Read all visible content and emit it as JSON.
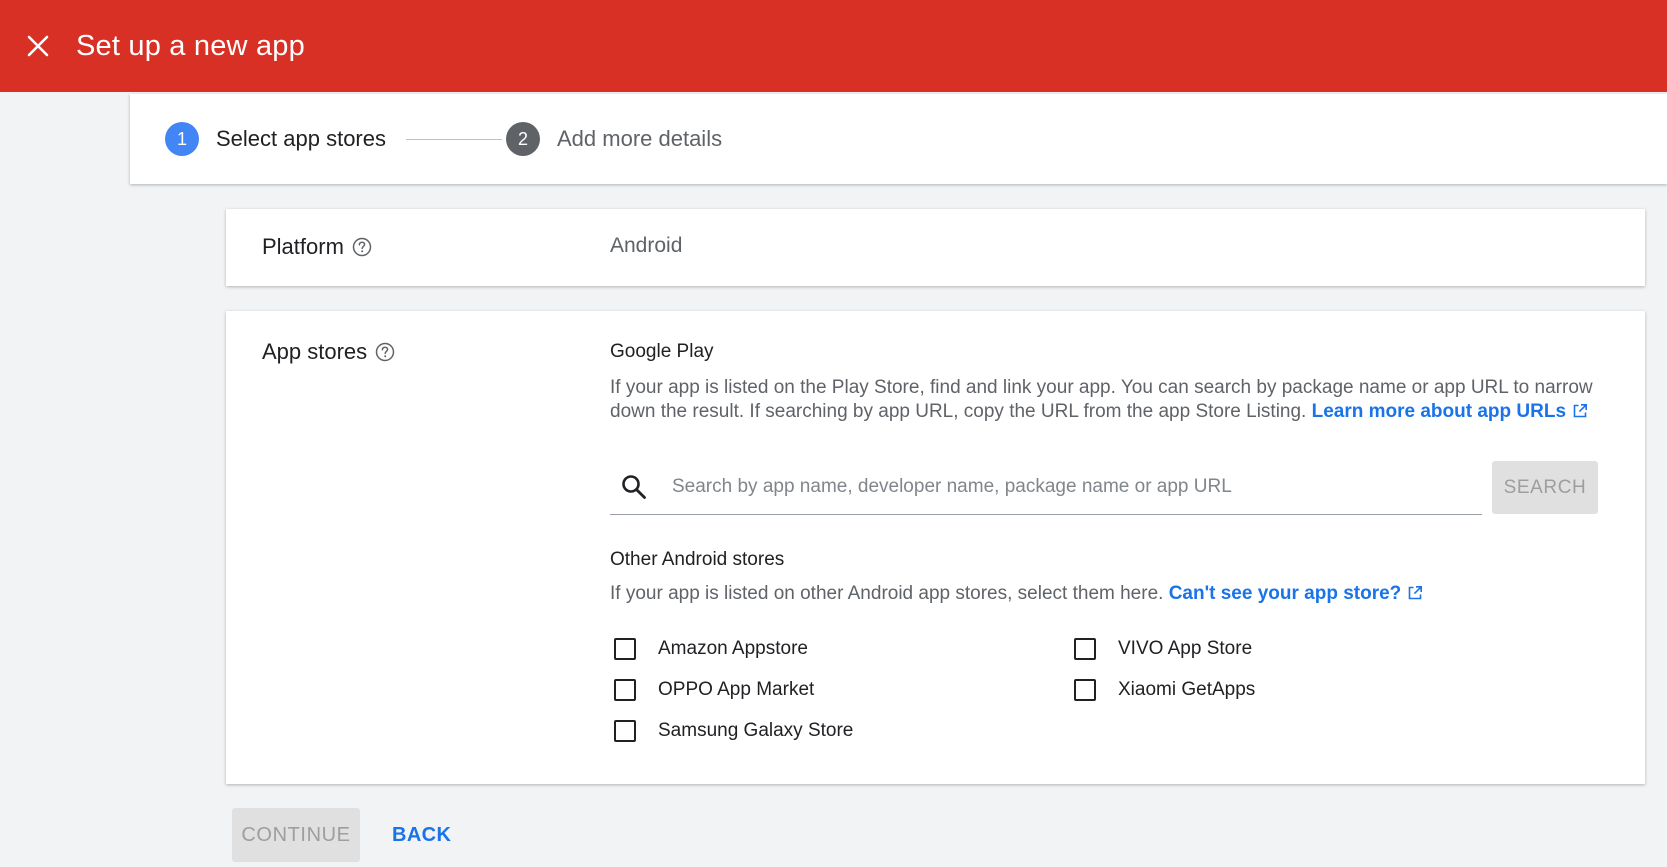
{
  "header": {
    "title": "Set up a new app",
    "close_icon": "close-icon",
    "background_color": "#d93025"
  },
  "stepper": {
    "steps": [
      {
        "number": "1",
        "label": "Select app stores",
        "state": "active"
      },
      {
        "number": "2",
        "label": "Add more details",
        "state": "inactive"
      }
    ]
  },
  "platform": {
    "label": "Platform",
    "value": "Android",
    "help_icon": "help-icon"
  },
  "app_stores": {
    "label": "App stores",
    "help_icon": "help-icon",
    "google_play": {
      "title": "Google Play",
      "description": "If your app is listed on the Play Store, find and link your app. You can search by package name or app URL to narrow down the result. If searching by app URL, copy the URL from the app Store Listing. ",
      "link_text": "Learn more about app URLs",
      "search_placeholder": "Search by app name, developer name, package name or app URL",
      "search_value": "",
      "search_button": "SEARCH"
    },
    "other_stores": {
      "title": "Other Android stores",
      "description": "If your app is listed on other Android app stores, select them here. ",
      "link_text": "Can't see your app store?",
      "options": [
        {
          "label": "Amazon Appstore",
          "checked": false
        },
        {
          "label": "OPPO App Market",
          "checked": false
        },
        {
          "label": "Samsung Galaxy Store",
          "checked": false
        },
        {
          "label": "VIVO App Store",
          "checked": false
        },
        {
          "label": "Xiaomi GetApps",
          "checked": false
        }
      ]
    }
  },
  "footer": {
    "continue_label": "CONTINUE",
    "back_label": "BACK"
  },
  "colors": {
    "accent": "#1a73e8",
    "step_active": "#4285f4",
    "step_inactive": "#5f6368"
  }
}
